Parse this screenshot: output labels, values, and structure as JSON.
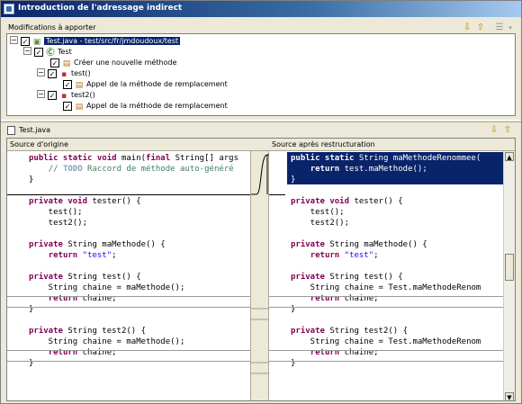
{
  "window": {
    "title": "Introduction de l'adressage indirect"
  },
  "changes_section": {
    "label": "Modifications à apporter",
    "tree": [
      {
        "label": "Test.java - test/src/fr/jmdoudoux/test",
        "checked": true,
        "selected": true,
        "icon": "java-file-icon"
      },
      {
        "label": "Test",
        "checked": true,
        "icon": "class-icon"
      },
      {
        "label": "Créer une nouvelle méthode",
        "checked": true,
        "icon": "change-icon"
      },
      {
        "label": "test()",
        "checked": true,
        "icon": "method-icon"
      },
      {
        "label": "Appel de la méthode de remplacement",
        "checked": true,
        "icon": "change-icon"
      },
      {
        "label": "test2()",
        "checked": true,
        "icon": "method-icon"
      },
      {
        "label": "Appel de la méthode de remplacement",
        "checked": true,
        "icon": "change-icon"
      }
    ]
  },
  "preview_section": {
    "file_label": "Test.java",
    "left_header": "Source d'origine",
    "right_header": "Source après restructuration"
  },
  "left_code": [
    [
      [
        "kw",
        "public static void "
      ],
      [
        "t",
        "main("
      ],
      [
        "kw",
        "final "
      ],
      [
        "t",
        "String[] args"
      ]
    ],
    [
      [
        "t",
        "    "
      ],
      [
        "cmt",
        "// "
      ],
      [
        "todo",
        "TODO"
      ],
      [
        "cmt",
        " Raccord de méthode auto-généré"
      ]
    ],
    [
      [
        "t",
        "}"
      ]
    ],
    [],
    [
      [
        "kw",
        "private void "
      ],
      [
        "t",
        "tester() {"
      ]
    ],
    [
      [
        "t",
        "    test();"
      ]
    ],
    [
      [
        "t",
        "    test2();"
      ]
    ],
    [],
    [
      [
        "kw",
        "private "
      ],
      [
        "t",
        "String maMethode() {"
      ]
    ],
    [
      [
        "t",
        "    "
      ],
      [
        "kw",
        "return "
      ],
      [
        "str",
        "\"test\""
      ],
      [
        "t",
        ";"
      ]
    ],
    [],
    [
      [
        "kw",
        "private "
      ],
      [
        "t",
        "String test() {"
      ]
    ],
    [
      [
        "t",
        "    String chaine = maMethode();"
      ]
    ],
    [
      [
        "t",
        "    "
      ],
      [
        "kw",
        "return "
      ],
      [
        "t",
        "chaine;"
      ]
    ],
    [
      [
        "t",
        "}"
      ]
    ],
    [],
    [
      [
        "kw",
        "private "
      ],
      [
        "t",
        "String test2() {"
      ]
    ],
    [
      [
        "t",
        "    String chaine = maMethode();"
      ]
    ],
    [
      [
        "t",
        "    "
      ],
      [
        "kw",
        "return "
      ],
      [
        "t",
        "chaine;"
      ]
    ],
    [
      [
        "t",
        "}"
      ]
    ]
  ],
  "right_code": [
    [
      [
        "kw",
        "public static "
      ],
      [
        "t",
        "String maMethodeRenommee("
      ]
    ],
    [
      [
        "t",
        "    "
      ],
      [
        "kw",
        "return "
      ],
      [
        "t",
        "test.maMethode();"
      ]
    ],
    [
      [
        "t",
        "}"
      ]
    ],
    [],
    [
      [
        "kw",
        "private void "
      ],
      [
        "t",
        "tester() {"
      ]
    ],
    [
      [
        "t",
        "    test();"
      ]
    ],
    [
      [
        "t",
        "    test2();"
      ]
    ],
    [],
    [
      [
        "kw",
        "private "
      ],
      [
        "t",
        "String maMethode() {"
      ]
    ],
    [
      [
        "t",
        "    "
      ],
      [
        "kw",
        "return "
      ],
      [
        "str",
        "\"test\""
      ],
      [
        "t",
        ";"
      ]
    ],
    [],
    [
      [
        "kw",
        "private "
      ],
      [
        "t",
        "String test() {"
      ]
    ],
    [
      [
        "t",
        "    String chaine = Test.maMethodeRenom"
      ]
    ],
    [
      [
        "t",
        "    "
      ],
      [
        "kw",
        "return "
      ],
      [
        "t",
        "chaine;"
      ]
    ],
    [
      [
        "t",
        "}"
      ]
    ],
    [],
    [
      [
        "kw",
        "private "
      ],
      [
        "t",
        "String test2() {"
      ]
    ],
    [
      [
        "t",
        "    String chaine = Test.maMethodeRenom"
      ]
    ],
    [
      [
        "t",
        "    "
      ],
      [
        "kw",
        "return "
      ],
      [
        "t",
        "chaine;"
      ]
    ],
    [
      [
        "t",
        "}"
      ]
    ]
  ],
  "colors": {
    "keyword": "#7f0055",
    "string": "#2a00ff",
    "comment": "#3f7f5f",
    "selection": "#0a246a"
  }
}
